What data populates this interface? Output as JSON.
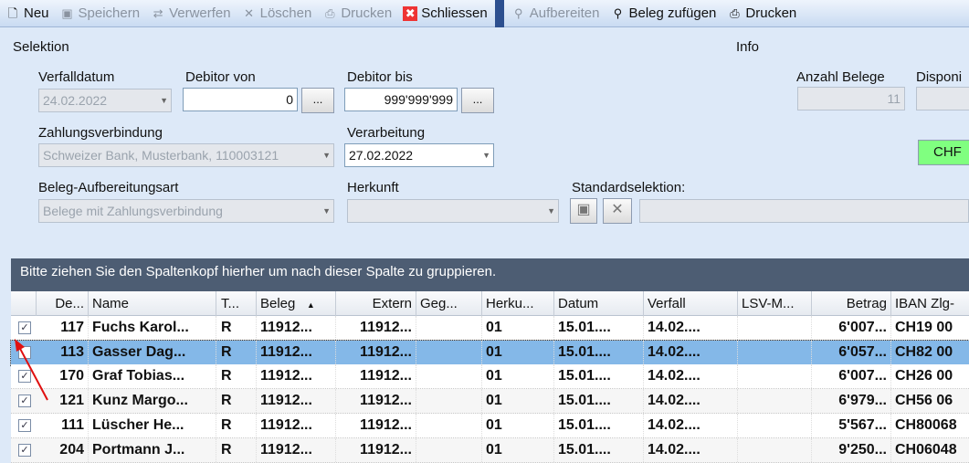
{
  "toolbar": {
    "items": [
      {
        "label": "Neu",
        "icon": "new-document-icon",
        "enabled": true
      },
      {
        "label": "Speichern",
        "icon": "save-icon",
        "enabled": false
      },
      {
        "label": "Verwerfen",
        "icon": "discard-icon",
        "enabled": false
      },
      {
        "label": "Löschen",
        "icon": "delete-icon",
        "enabled": false
      },
      {
        "label": "Drucken",
        "icon": "print-icon",
        "enabled": false
      },
      {
        "label": "Schliessen",
        "icon": "close-icon",
        "enabled": true
      }
    ],
    "items2": [
      {
        "label": "Aufbereiten",
        "icon": "search-icon",
        "enabled": false
      },
      {
        "label": "Beleg zufügen",
        "icon": "search-icon",
        "enabled": true
      },
      {
        "label": "Drucken",
        "icon": "print-icon",
        "enabled": true
      }
    ]
  },
  "selektion": {
    "title": "Selektion",
    "verfalldatum_label": "Verfalldatum",
    "verfalldatum": "24.02.2022",
    "debitor_von_label": "Debitor von",
    "debitor_von": "0",
    "debitor_bis_label": "Debitor bis",
    "debitor_bis": "999'999'999",
    "ellipsis": "...",
    "zahlungsverbindung_label": "Zahlungsverbindung",
    "zahlungsverbindung": "Schweizer Bank, Musterbank, 110003121",
    "verarbeitung_label": "Verarbeitung",
    "verarbeitung": "27.02.2022",
    "aufbereitungsart_label": "Beleg-Aufbereitungsart",
    "aufbereitungsart": "Belege mit Zahlungsverbindung",
    "herkunft_label": "Herkunft",
    "herkunft": "",
    "standardselektion_label": "Standardselektion:"
  },
  "info": {
    "title": "Info",
    "anzahl_label": "Anzahl Belege",
    "anzahl": "11",
    "disponi_label": "Disponi",
    "currency": "CHF"
  },
  "grid": {
    "group_hint": "Bitte ziehen Sie den Spaltenkopf hierher um nach dieser Spalte zu gruppieren.",
    "columns": [
      "De...",
      "Name",
      "T...",
      "Beleg",
      "Extern",
      "Geg...",
      "Herku...",
      "Datum",
      "Verfall",
      "LSV-M...",
      "Betrag",
      "IBAN Zlg-"
    ],
    "rows": [
      {
        "checked": true,
        "cells": [
          "117",
          "Fuchs Karol...",
          "R",
          "11912...",
          "11912...",
          "",
          "01",
          "15.01....",
          "14.02....",
          "",
          "6'007...",
          "CH19 00"
        ]
      },
      {
        "checked": false,
        "selected": true,
        "cells": [
          "113",
          "Gasser Dag...",
          "R",
          "11912...",
          "11912...",
          "",
          "01",
          "15.01....",
          "14.02....",
          "",
          "6'057...",
          "CH82 00"
        ]
      },
      {
        "checked": true,
        "cells": [
          "170",
          "Graf Tobias...",
          "R",
          "11912...",
          "11912...",
          "",
          "01",
          "15.01....",
          "14.02....",
          "",
          "6'007...",
          "CH26 00"
        ]
      },
      {
        "checked": true,
        "cells": [
          "121",
          "Kunz Margo...",
          "R",
          "11912...",
          "11912...",
          "",
          "01",
          "15.01....",
          "14.02....",
          "",
          "6'979...",
          "CH56 06"
        ]
      },
      {
        "checked": true,
        "cells": [
          "111",
          "Lüscher He...",
          "R",
          "11912...",
          "11912...",
          "",
          "01",
          "15.01....",
          "14.02....",
          "",
          "5'567...",
          "CH80068"
        ]
      },
      {
        "checked": true,
        "cells": [
          "204",
          "Portmann J...",
          "R",
          "11912...",
          "11912...",
          "",
          "01",
          "15.01....",
          "14.02....",
          "",
          "9'250...",
          "CH06048"
        ]
      }
    ]
  }
}
